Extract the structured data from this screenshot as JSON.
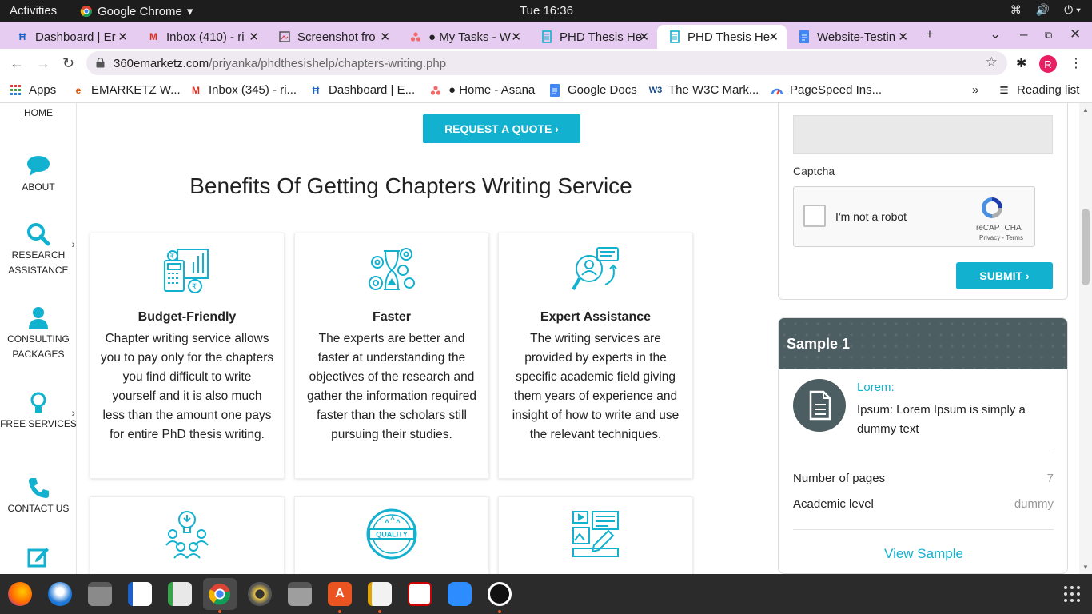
{
  "system_bar": {
    "activities": "Activities",
    "app_name": "Google Chrome",
    "clock": "Tue 16:36"
  },
  "tabs": [
    {
      "title": "Dashboard | Er",
      "icon": "jira-icon"
    },
    {
      "title": "Inbox (410) - ri",
      "icon": "gmail-icon"
    },
    {
      "title": "Screenshot fro",
      "icon": "screenshot-icon"
    },
    {
      "title": "● My Tasks - W",
      "icon": "asana-icon"
    },
    {
      "title": "PHD Thesis He",
      "icon": "site-icon"
    },
    {
      "title": "PHD Thesis He",
      "icon": "site-icon",
      "active": true
    },
    {
      "title": "Website-Testin",
      "icon": "docs-icon"
    }
  ],
  "address_bar": {
    "host": "360emarketz.com",
    "path": "/priyanka/phdthesishelp/chapters-writing.php",
    "profile_initial": "R"
  },
  "bookmarks": [
    {
      "label": "Apps",
      "icon": "apps-grid-icon"
    },
    {
      "label": "EMARKETZ W...",
      "icon": "emarketz-icon"
    },
    {
      "label": "Inbox (345) - ri...",
      "icon": "gmail-icon"
    },
    {
      "label": "Dashboard | E...",
      "icon": "jira-icon"
    },
    {
      "label": "● Home - Asana",
      "icon": "asana-icon"
    },
    {
      "label": "Google Docs",
      "icon": "docs-icon"
    },
    {
      "label": "The W3C Mark...",
      "icon": "w3c-icon"
    },
    {
      "label": "PageSpeed Ins...",
      "icon": "pagespeed-icon"
    }
  ],
  "reading_list": "Reading list",
  "side_nav": [
    {
      "label": "HOME"
    },
    {
      "label": "ABOUT",
      "icon": "chat-icon"
    },
    {
      "label": "RESEARCH ASSISTANCE",
      "icon": "search-icon"
    },
    {
      "label": "CONSULTING PACKAGES",
      "icon": "user-icon"
    },
    {
      "label": "FREE SERVICES",
      "icon": "bulb-icon"
    },
    {
      "label": "CONTACT US",
      "icon": "phone-icon"
    },
    {
      "label": "",
      "icon": "edit-icon"
    }
  ],
  "main": {
    "quote_button": "REQUEST A QUOTE ›",
    "heading": "Benefits Of Getting Chapters Writing Service",
    "cards": [
      {
        "title": "Budget-Friendly",
        "icon": "calculator-chart-icon",
        "text": "Chapter writing service allows you to pay only for the chapters you find difficult to write yourself and it is also much less than the amount one pays for entire PhD thesis writing."
      },
      {
        "title": "Faster",
        "icon": "hourglass-gears-icon",
        "text": "The experts are better and faster at understanding the objectives of the research and gather the information required faster than the scholars still pursuing their studies."
      },
      {
        "title": "Expert Assistance",
        "icon": "expert-search-icon",
        "text": "The writing services are provided by experts in the specific academic field giving them years of experience and insight of how to write and use the relevant techniques."
      }
    ],
    "second_row_icons": [
      "team-idea-icon",
      "quality-badge-icon",
      "design-tools-icon"
    ],
    "quality_badge_text": "QUALITY"
  },
  "form": {
    "captcha_label": "Captcha",
    "recaptcha_text": "I'm not a robot",
    "recaptcha_brand": "reCAPTCHA",
    "recaptcha_terms": "Privacy - Terms",
    "submit": "SUBMIT ›"
  },
  "sample": {
    "title": "Sample 1",
    "lorem_title": "Lorem:",
    "lorem_text": "Ipsum: Lorem Ipsum is simply a dummy text",
    "pages_label": "Number of pages",
    "pages_value": "7",
    "level_label": "Academic level",
    "level_value": "dummy",
    "view_link": "View Sample"
  },
  "colors": {
    "accent": "#11b1cf",
    "sample_header": "#4d5e62",
    "tabstrip": "#e6ccf0"
  },
  "dock_apps": [
    "firefox-icon",
    "thunderbird-icon",
    "files-icon",
    "writer-icon",
    "calc-icon",
    "chrome-icon",
    "rhythmbox-icon",
    "camera-icon",
    "software-icon",
    "text-editor-icon",
    "screenshot-app-icon",
    "zoom-icon",
    "inkscape-icon"
  ]
}
